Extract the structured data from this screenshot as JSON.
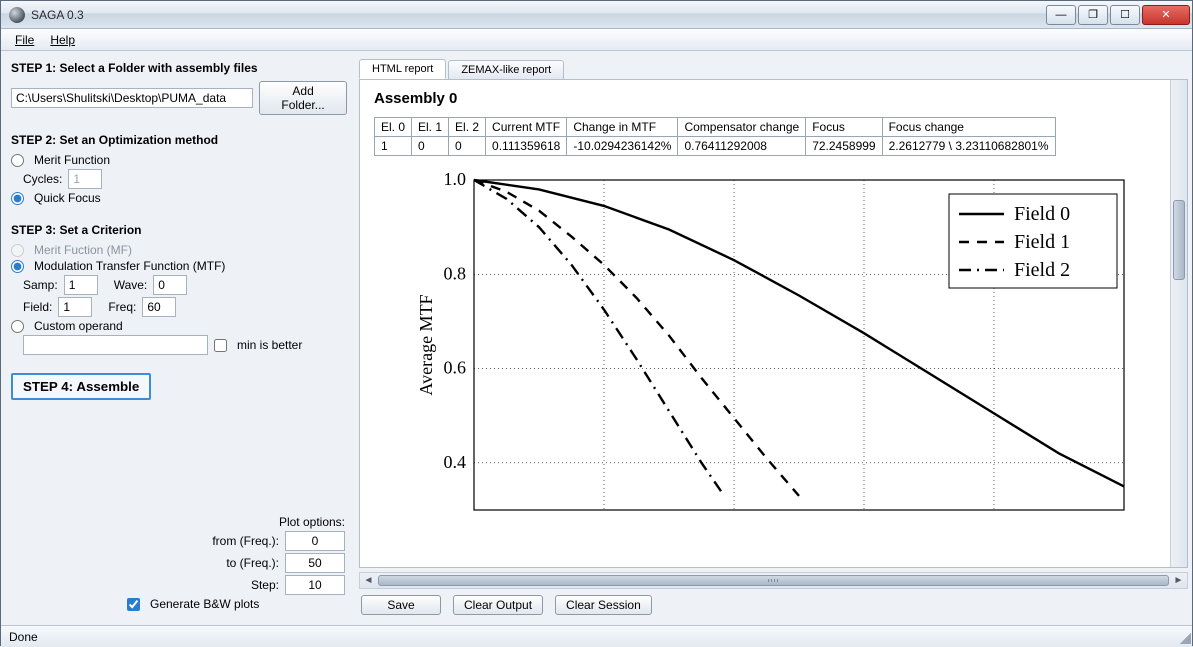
{
  "window": {
    "title": "SAGA 0.3"
  },
  "menubar": {
    "file": "File",
    "help": "Help"
  },
  "status": "Done",
  "step1": {
    "title": "STEP 1: Select a Folder with assembly files",
    "path": "C:\\Users\\Shulitski\\Desktop\\PUMA_data",
    "add_folder": "Add Folder..."
  },
  "step2": {
    "title": "STEP 2: Set an Optimization method",
    "merit_label": "Merit Function",
    "cycles_label": "Cycles:",
    "cycles_value": "1",
    "quick_label": "Quick Focus"
  },
  "step3": {
    "title": "STEP 3: Set a Criterion",
    "mf_label": "Merit Fuction (MF)",
    "mtf_label": "Modulation Transfer Function (MTF)",
    "samp_label": "Samp:",
    "samp": "1",
    "wave_label": "Wave:",
    "wave": "0",
    "field_label": "Field:",
    "field": "1",
    "freq_label": "Freq:",
    "freq": "60",
    "custom_label": "Custom operand",
    "min_label": "min is better"
  },
  "step4": {
    "label": "STEP 4: Assemble"
  },
  "plot_options": {
    "label": "Plot options:",
    "from_label": "from (Freq.):",
    "from": "0",
    "to_label": "to (Freq.):",
    "to": "50",
    "step_label": "Step:",
    "step": "10",
    "bw_label": "Generate B&W plots"
  },
  "tabs": {
    "html": "HTML report",
    "zemax": "ZEMAX-like report"
  },
  "report": {
    "title": "Assembly 0",
    "headers": [
      "El. 0",
      "El. 1",
      "El. 2",
      "Current MTF",
      "Change in MTF",
      "Compensator change",
      "Focus",
      "Focus change"
    ],
    "row": [
      "1",
      "0",
      "0",
      "0.111359618",
      "-10.0294236142%",
      "0.76411292008",
      "72.2458999",
      "2.2612779 \\ 3.23110682801%"
    ]
  },
  "buttons": {
    "save": "Save",
    "clear_output": "Clear Output",
    "clear_session": "Clear Session"
  },
  "chart_data": {
    "type": "line",
    "ylabel": "Average MTF",
    "ylim": [
      0.3,
      1.0
    ],
    "yticks": [
      0.4,
      0.6,
      0.8,
      1.0
    ],
    "xlim": [
      0,
      100
    ],
    "series": [
      {
        "name": "Field 0",
        "style": "solid",
        "points": [
          [
            0,
            1.0
          ],
          [
            10,
            0.98
          ],
          [
            20,
            0.945
          ],
          [
            30,
            0.895
          ],
          [
            40,
            0.83
          ],
          [
            50,
            0.755
          ],
          [
            60,
            0.675
          ],
          [
            70,
            0.59
          ],
          [
            80,
            0.505
          ],
          [
            90,
            0.42
          ],
          [
            100,
            0.35
          ]
        ]
      },
      {
        "name": "Field 1",
        "style": "dashed",
        "points": [
          [
            0,
            1.0
          ],
          [
            5,
            0.975
          ],
          [
            10,
            0.935
          ],
          [
            15,
            0.88
          ],
          [
            20,
            0.82
          ],
          [
            25,
            0.75
          ],
          [
            30,
            0.67
          ],
          [
            35,
            0.58
          ],
          [
            40,
            0.495
          ],
          [
            45,
            0.41
          ],
          [
            50,
            0.33
          ]
        ]
      },
      {
        "name": "Field 2",
        "style": "dashdot",
        "points": [
          [
            0,
            1.0
          ],
          [
            5,
            0.96
          ],
          [
            10,
            0.9
          ],
          [
            15,
            0.82
          ],
          [
            20,
            0.725
          ],
          [
            25,
            0.62
          ],
          [
            30,
            0.51
          ],
          [
            35,
            0.4
          ],
          [
            38,
            0.34
          ]
        ]
      }
    ],
    "legend_pos": "top-right"
  }
}
